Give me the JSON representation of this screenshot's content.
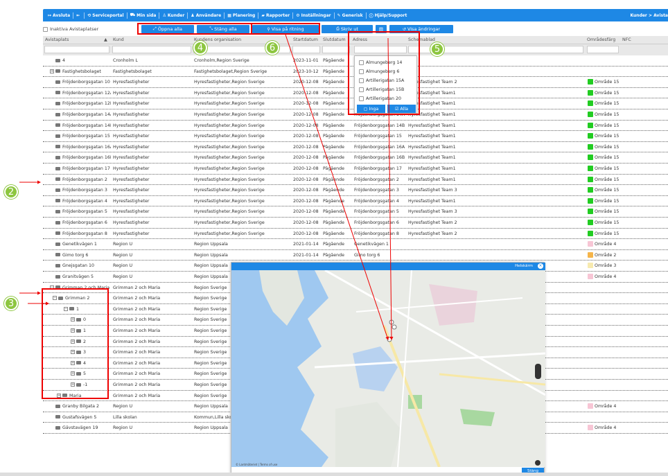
{
  "nav": {
    "items": [
      {
        "icon": "exit-icon",
        "label": "Avsluta"
      },
      {
        "icon": "back-icon",
        "label": ""
      },
      {
        "icon": "portal-icon",
        "label": "Serviceportal"
      },
      {
        "icon": "car-icon",
        "label": "Min sida"
      },
      {
        "icon": "customers-icon",
        "label": "Kunder"
      },
      {
        "icon": "user-icon",
        "label": "Användare"
      },
      {
        "icon": "calendar-icon",
        "label": "Planering"
      },
      {
        "icon": "chart-icon",
        "label": "Rapporter"
      },
      {
        "icon": "settings-icon",
        "label": "Inställningar"
      },
      {
        "icon": "wrench-icon",
        "label": "Generisk"
      },
      {
        "icon": "info-icon",
        "label": "Hjälp/Support"
      }
    ],
    "breadcrumb": "Kunder > Avista"
  },
  "toolbar": {
    "inactive_label": "Inaktiva Avistaplatser",
    "open_all": "Öppna alla",
    "close_all": "Stäng alla",
    "show_on_drawing": "Visa på ritning",
    "print": "Skriv ut",
    "show_changes": "Visa ändringar"
  },
  "columns": {
    "avistaplats": "Avistaplats",
    "kund": "Kund",
    "org": "Kundens organisation",
    "start": "Startdatum",
    "slut": "Slutdatum",
    "adress": "Adress",
    "schema": "Schemablad",
    "omrade": "Områdesfärg",
    "nfc": "NFC"
  },
  "rows": [
    {
      "plats": "4",
      "kund": "Cronholm L",
      "org": "Cronholm,Region Sverige",
      "start": "2023-11-01",
      "slut": "Pågående",
      "adress": "",
      "schema": "",
      "omrade": "",
      "color": ""
    },
    {
      "plats": "Fastighetsbolaget",
      "kund": "Fastighetsbolaget",
      "org": "Fastighetsbolaget,Region Sverige",
      "start": "2023-10-12",
      "slut": "Pågående",
      "adress": "",
      "schema": "",
      "omrade": "",
      "color": ""
    },
    {
      "plats": "Fröjdenborgsgatan 10",
      "kund": "Hyresfastigheter",
      "org": "Hyresfastigheter,Region Sverige",
      "start": "2020-12-08",
      "slut": "Pågående",
      "adress": "",
      "schema": "Hyresfastighet Team 2",
      "omrade": "Område 15",
      "color": "#22cc22"
    },
    {
      "plats": "Fröjdenborgsgatan 12A",
      "kund": "Hyresfastigheter",
      "org": "Hyresfastigheter,Region Sverige",
      "start": "2020-12-08",
      "slut": "Pågående",
      "adress": "",
      "schema": "Hyresfastighet Team1",
      "omrade": "Område 15",
      "color": "#22cc22"
    },
    {
      "plats": "Fröjdenborgsgatan 12B",
      "kund": "Hyresfastigheter",
      "org": "Hyresfastigheter,Region Sverige",
      "start": "2020-12-08",
      "slut": "Pågående",
      "adress": "",
      "schema": "Hyresfastighet Team1",
      "omrade": "Område 15",
      "color": "#22cc22"
    },
    {
      "plats": "Fröjdenborgsgatan 14A",
      "kund": "Hyresfastigheter",
      "org": "Hyresfastigheter,Region Sverige",
      "start": "2020-12-08",
      "slut": "Pågående",
      "adress": "Fröjdenborgsgatan 14A",
      "schema": "Hyresfastighet Team1",
      "omrade": "Område 15",
      "color": "#22cc22"
    },
    {
      "plats": "Fröjdenborgsgatan 14B",
      "kund": "Hyresfastigheter",
      "org": "Hyresfastigheter,Region Sverige",
      "start": "2020-12-08",
      "slut": "Pågående",
      "adress": "Fröjdenborgsgatan 14B",
      "schema": "Hyresfastighet Team1",
      "omrade": "Område 15",
      "color": "#22cc22"
    },
    {
      "plats": "Fröjdenborgsgatan 15",
      "kund": "Hyresfastigheter",
      "org": "Hyresfastigheter,Region Sverige",
      "start": "2020-12-08",
      "slut": "Pågående",
      "adress": "Fröjdenborgsgatan 15",
      "schema": "Hyresfastighet Team1",
      "omrade": "Område 15",
      "color": "#22cc22"
    },
    {
      "plats": "Fröjdenborgsgatan 16A",
      "kund": "Hyresfastigheter",
      "org": "Hyresfastigheter,Region Sverige",
      "start": "2020-12-08",
      "slut": "Pågående",
      "adress": "Fröjdenborgsgatan 16A",
      "schema": "Hyresfastighet Team1",
      "omrade": "Område 15",
      "color": "#22cc22"
    },
    {
      "plats": "Fröjdenborgsgatan 16B",
      "kund": "Hyresfastigheter",
      "org": "Hyresfastigheter,Region Sverige",
      "start": "2020-12-08",
      "slut": "Pågående",
      "adress": "Fröjdenborgsgatan 16B",
      "schema": "Hyresfastighet Team1",
      "omrade": "Område 15",
      "color": "#22cc22"
    },
    {
      "plats": "Fröjdenborgsgatan 17",
      "kund": "Hyresfastigheter",
      "org": "Hyresfastigheter,Region Sverige",
      "start": "2020-12-08",
      "slut": "Pågående",
      "adress": "Fröjdenborgsgatan 17",
      "schema": "Hyresfastighet Team1",
      "omrade": "Område 15",
      "color": "#22cc22"
    },
    {
      "plats": "Fröjdenborgsgatan 2",
      "kund": "Hyresfastigheter",
      "org": "Hyresfastigheter,Region Sverige",
      "start": "2020-12-08",
      "slut": "Pågående",
      "adress": "Fröjdenborgsgatan 2",
      "schema": "Hyresfastighet Team1",
      "omrade": "Område 15",
      "color": "#22cc22"
    },
    {
      "plats": "Fröjdenborgsgatan 3",
      "kund": "Hyresfastigheter",
      "org": "Hyresfastigheter,Region Sverige",
      "start": "2020-12-08",
      "slut": "Pågående",
      "adress": "Fröjdenborgsgatan 3",
      "schema": "Hyresfastighet Team 3",
      "omrade": "Område 15",
      "color": "#22cc22"
    },
    {
      "plats": "Fröjdenborgsgatan 4",
      "kund": "Hyresfastigheter",
      "org": "Hyresfastigheter,Region Sverige",
      "start": "2020-12-08",
      "slut": "Pågående",
      "adress": "Fröjdenborgsgatan 4",
      "schema": "Hyresfastighet Team1",
      "omrade": "Område 15",
      "color": "#22cc22"
    },
    {
      "plats": "Fröjdenborgsgatan 5",
      "kund": "Hyresfastigheter",
      "org": "Hyresfastigheter,Region Sverige",
      "start": "2020-12-08",
      "slut": "Pågående",
      "adress": "Fröjdenborgsgatan 5",
      "schema": "Hyresfastighet Team 3",
      "omrade": "Område 15",
      "color": "#22cc22"
    },
    {
      "plats": "Fröjdenborgsgatan 6",
      "kund": "Hyresfastigheter",
      "org": "Hyresfastigheter,Region Sverige",
      "start": "2020-12-08",
      "slut": "Pågående",
      "adress": "Fröjdenborgsgatan 6",
      "schema": "Hyresfastighet Team 2",
      "omrade": "Område 15",
      "color": "#22cc22"
    },
    {
      "plats": "Fröjdenborgsgatan 8",
      "kund": "Hyresfastigheter",
      "org": "Hyresfastigheter,Region Sverige",
      "start": "2020-12-08",
      "slut": "Pågående",
      "adress": "Fröjdenborgsgatan 8",
      "schema": "Hyresfastighet Team 2",
      "omrade": "Område 15",
      "color": "#22cc22"
    },
    {
      "plats": "Genetikvägen 1",
      "kund": "Region U",
      "org": "Region Uppsala",
      "start": "2021-01-14",
      "slut": "Pågående",
      "adress": "Genetikvägen 1",
      "schema": "",
      "omrade": "Område 4",
      "color": "#f7c6d5"
    },
    {
      "plats": "Gimo torg 6",
      "kund": "Region U",
      "org": "Region Uppsala",
      "start": "2021-01-14",
      "slut": "Pågående",
      "adress": "Gimo torg 6",
      "schema": "",
      "omrade": "Område 2",
      "color": "#f5b54a"
    },
    {
      "plats": "Gnejsgatan 10",
      "kund": "Region U",
      "org": "Region Uppsala",
      "start": "",
      "slut": "",
      "adress": "",
      "schema": "",
      "omrade": "Område 3",
      "color": "#f7eab0"
    },
    {
      "plats": "Granitvägen 5",
      "kund": "Region U",
      "org": "Region Uppsala",
      "start": "",
      "slut": "",
      "adress": "",
      "schema": "",
      "omrade": "Område 4",
      "color": "#f7c6d5"
    },
    {
      "plats": "Grimman 2 och Maria",
      "kund": "Grimman 2 och Maria",
      "org": "Region Sverige",
      "start": "",
      "slut": "",
      "adress": "",
      "schema": "",
      "omrade": "",
      "color": ""
    },
    {
      "plats": "Grimman 2",
      "kund": "Grimman 2 och Maria",
      "org": "Region Sverige",
      "start": "",
      "slut": "",
      "adress": "",
      "schema": "",
      "omrade": "",
      "color": ""
    },
    {
      "plats": "1",
      "kund": "Grimman 2 och Maria",
      "org": "Region Sverige",
      "start": "",
      "slut": "",
      "adress": "",
      "schema": "",
      "omrade": "",
      "color": ""
    },
    {
      "plats": "0",
      "kund": "Grimman 2 och Maria",
      "org": "Region Sverige",
      "start": "",
      "slut": "",
      "adress": "",
      "schema": "",
      "omrade": "",
      "color": ""
    },
    {
      "plats": "1",
      "kund": "Grimman 2 och Maria",
      "org": "Region Sverige",
      "start": "",
      "slut": "",
      "adress": "",
      "schema": "",
      "omrade": "",
      "color": ""
    },
    {
      "plats": "2",
      "kund": "Grimman 2 och Maria",
      "org": "Region Sverige",
      "start": "",
      "slut": "",
      "adress": "",
      "schema": "",
      "omrade": "",
      "color": ""
    },
    {
      "plats": "3",
      "kund": "Grimman 2 och Maria",
      "org": "Region Sverige",
      "start": "",
      "slut": "",
      "adress": "",
      "schema": "",
      "omrade": "",
      "color": ""
    },
    {
      "plats": "4",
      "kund": "Grimman 2 och Maria",
      "org": "Region Sverige",
      "start": "",
      "slut": "",
      "adress": "",
      "schema": "",
      "omrade": "",
      "color": ""
    },
    {
      "plats": "5",
      "kund": "Grimman 2 och Maria",
      "org": "Region Sverige",
      "start": "",
      "slut": "",
      "adress": "",
      "schema": "",
      "omrade": "",
      "color": ""
    },
    {
      "plats": "-1",
      "kund": "Grimman 2 och Maria",
      "org": "Region Sverige",
      "start": "",
      "slut": "",
      "adress": "",
      "schema": "",
      "omrade": "",
      "color": ""
    },
    {
      "plats": "Maria",
      "kund": "Grimman 2 och Maria",
      "org": "Region Sverige",
      "start": "",
      "slut": "",
      "adress": "",
      "schema": "",
      "omrade": "",
      "color": ""
    },
    {
      "plats": "Granby Bilgata 2",
      "kund": "Region U",
      "org": "Region Uppsala",
      "start": "",
      "slut": "",
      "adress": "",
      "schema": "",
      "omrade": "Område 4",
      "color": "#f7c6d5"
    },
    {
      "plats": "Gustafsvägen 5",
      "kund": "Lilla skolan",
      "org": "Kommun,Lilla skolan",
      "start": "",
      "slut": "",
      "adress": "",
      "schema": "",
      "omrade": "",
      "color": ""
    },
    {
      "plats": "Gävstavägen 19",
      "kund": "Region U",
      "org": "Region Uppsala",
      "start": "",
      "slut": "",
      "adress": "",
      "schema": "",
      "omrade": "Område 4",
      "color": "#f7c6d5"
    }
  ],
  "address_filter": {
    "options": [
      "Almungeberg 14",
      "Almungeberg 6",
      "Artillerigatan 15A",
      "Artillerigatan 15B",
      "Artillerigatan 20"
    ],
    "none_label": "Inga",
    "all_label": "Alla"
  },
  "map": {
    "title_right": "Helskärm",
    "close_label": "Stäng",
    "attribution": "© Lantmäteriet | Terms of use"
  },
  "annotations": [
    "2",
    "3",
    "4",
    "5",
    "6"
  ]
}
